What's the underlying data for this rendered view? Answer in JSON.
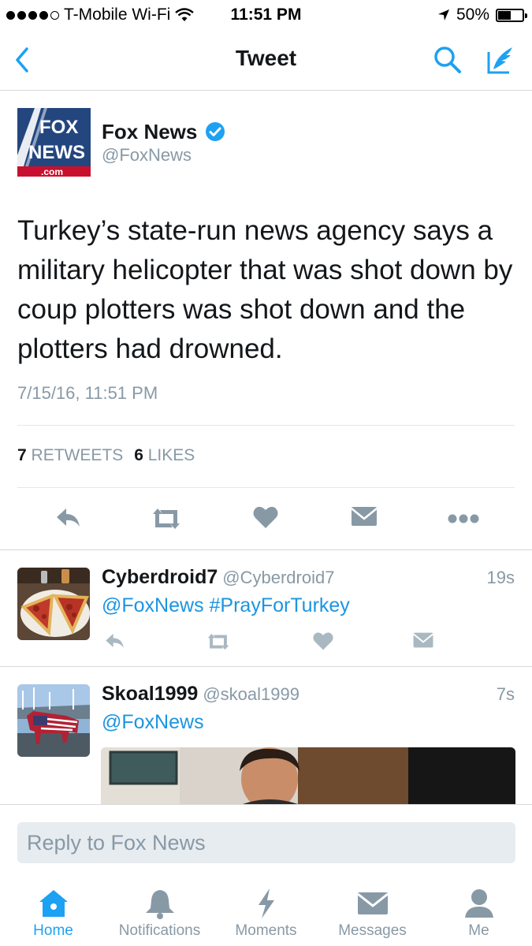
{
  "status_bar": {
    "carrier": "T-Mobile Wi-Fi",
    "time": "11:51 PM",
    "battery_pct": "50%",
    "battery_level": 0.5
  },
  "nav": {
    "title": "Tweet"
  },
  "tweet": {
    "author_name": "Fox News",
    "author_handle": "@FoxNews",
    "logo_text_top": "FOX",
    "logo_text_bottom": "NEWS",
    "logo_text_com": ".com",
    "text": "Turkey’s state-run news agency says a military helicopter that was shot down by coup plotters was shot down and the plotters had drowned.",
    "timestamp": "7/15/16, 11:51 PM",
    "retweet_count": "7",
    "retweet_label": "RETWEETS",
    "like_count": "6",
    "like_label": "LIKES"
  },
  "replies": [
    {
      "name": "Cyberdroid7",
      "handle": "@Cyberdroid7",
      "time": "19s",
      "text": "@FoxNews #PrayForTurkey"
    },
    {
      "name": "Skoal1999",
      "handle": "@skoal1999",
      "time": "7s",
      "text": "@FoxNews"
    }
  ],
  "reply_box": {
    "placeholder": "Reply to Fox News"
  },
  "tabs": [
    {
      "label": "Home",
      "icon": "home-icon"
    },
    {
      "label": "Notifications",
      "icon": "bell-icon"
    },
    {
      "label": "Moments",
      "icon": "lightning-icon"
    },
    {
      "label": "Messages",
      "icon": "envelope-icon"
    },
    {
      "label": "Me",
      "icon": "person-icon"
    }
  ],
  "colors": {
    "accent": "#1da1f2",
    "secondary_text": "#8899a6",
    "icon_gray": "#aab8c2"
  }
}
